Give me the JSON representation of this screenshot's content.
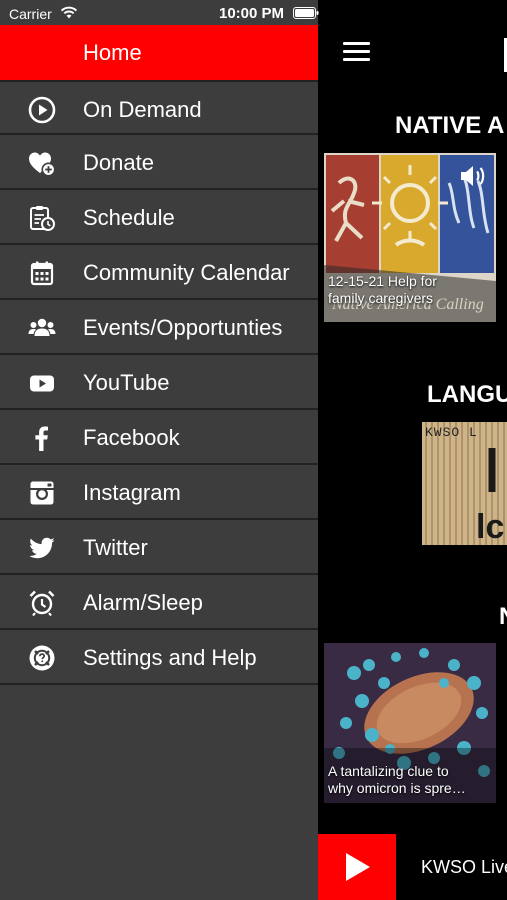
{
  "status_bar": {
    "carrier": "Carrier",
    "time": "10:00 PM"
  },
  "menu": {
    "home_label": "Home",
    "items": [
      {
        "label": "On Demand",
        "icon": "play-circle-icon"
      },
      {
        "label": "Donate",
        "icon": "heart-plus-icon"
      },
      {
        "label": "Schedule",
        "icon": "clipboard-clock-icon"
      },
      {
        "label": "Community Calendar",
        "icon": "calendar-icon"
      },
      {
        "label": "Events/Opportunties",
        "icon": "users-icon"
      },
      {
        "label": "YouTube",
        "icon": "youtube-icon"
      },
      {
        "label": "Facebook",
        "icon": "facebook-icon"
      },
      {
        "label": "Instagram",
        "icon": "instagram-icon"
      },
      {
        "label": "Twitter",
        "icon": "twitter-icon"
      },
      {
        "label": "Alarm/Sleep",
        "icon": "alarm-clock-icon"
      },
      {
        "label": "Settings and Help",
        "icon": "help-gear-icon"
      }
    ]
  },
  "content": {
    "sections": [
      {
        "title": "NATIVE A"
      },
      {
        "title": "LANGU"
      },
      {
        "title": "N"
      }
    ],
    "cards": [
      {
        "caption_line1": "12-15-21 Help for",
        "caption_line2": "family caregivers"
      },
      {
        "image_text_top": "KWSO L",
        "image_text_bottom": "lc"
      },
      {
        "caption_line1": "A tantalizing clue to",
        "caption_line2": "why omicron is spre…"
      }
    ],
    "player": {
      "title": "KWSO Live"
    }
  },
  "colors": {
    "accent": "#ff0000",
    "menu_bg": "#3d3d3d",
    "divider": "#222222",
    "content_bg": "#000000"
  }
}
